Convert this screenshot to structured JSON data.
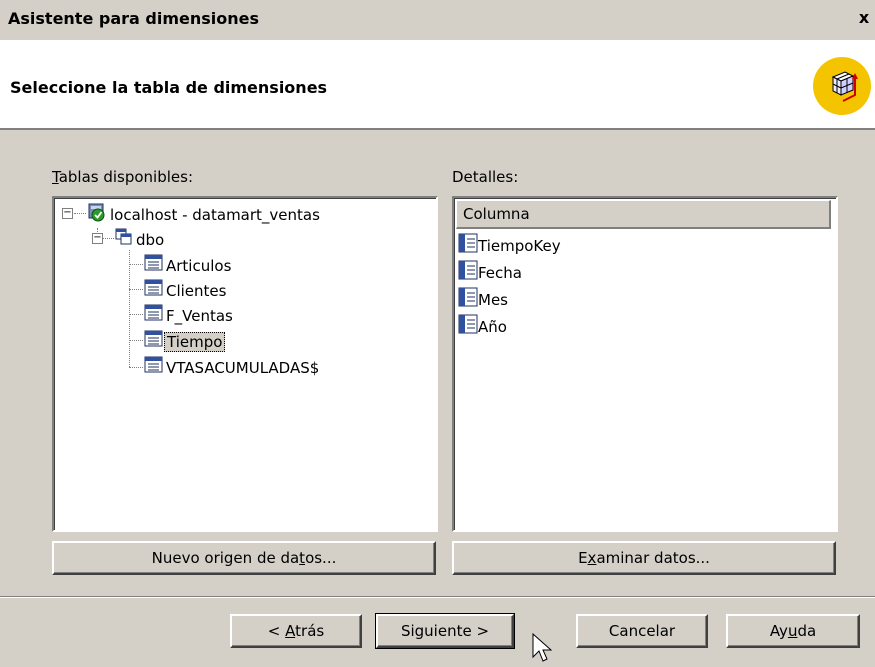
{
  "window": {
    "title": "Asistente para dimensiones",
    "close_glyph": "x"
  },
  "header": {
    "heading": "Seleccione la tabla de dimensiones",
    "icon": "cube-wizard-icon",
    "icon_color": "#f5c400"
  },
  "left_panel": {
    "label_first": "T",
    "label_rest": "ablas disponibles:",
    "tree": {
      "server": "localhost - datamart_ventas",
      "schema": "dbo",
      "tables": [
        "Articulos",
        "Clientes",
        "F_Ventas",
        "Tiempo",
        "VTASACUMULADAS$"
      ],
      "selected": "Tiempo"
    }
  },
  "right_panel": {
    "label": "Detalles:",
    "column_header": "Columna",
    "columns": [
      "TiempoKey",
      "Fecha",
      "Mes",
      "Año"
    ]
  },
  "buttons": {
    "new_source_pre": "Nuevo origen de da",
    "new_source_u": "t",
    "new_source_post": "os...",
    "browse_pre": "E",
    "browse_u": "x",
    "browse_post": "aminar datos...",
    "back_pre": "< ",
    "back_u": "A",
    "back_post": "trás",
    "next": "Siguiente >",
    "cancel": "Cancelar",
    "help_pre": "Ay",
    "help_u": "u",
    "help_post": "da"
  },
  "colors": {
    "dialog": "#d4d0c8",
    "selection_border": "#000000"
  }
}
